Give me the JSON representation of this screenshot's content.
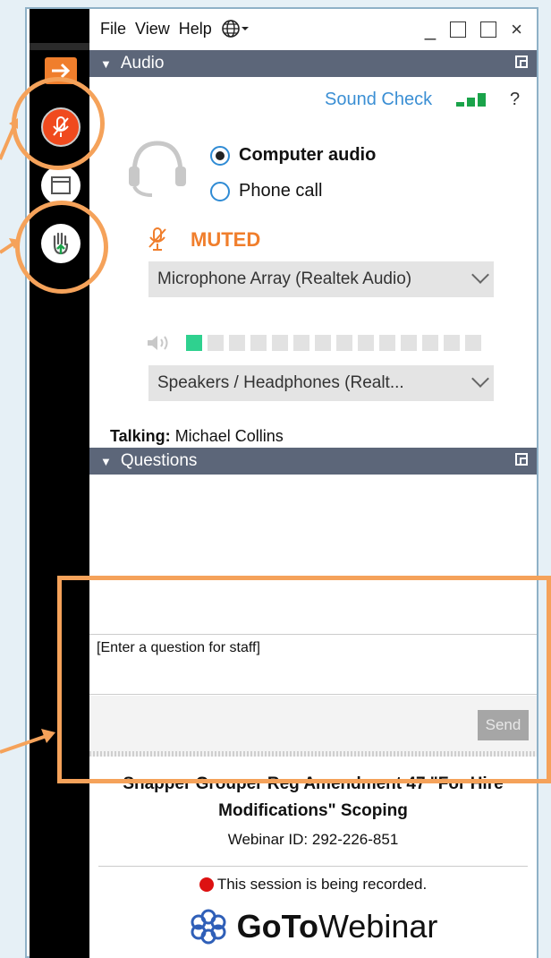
{
  "menu": {
    "file": "File",
    "view": "View",
    "help": "Help"
  },
  "audio": {
    "section_title": "Audio",
    "sound_check": "Sound Check",
    "help_mark": "?",
    "computer_audio": "Computer audio",
    "phone_call": "Phone call",
    "selected_option": "Computer audio",
    "mute_status": "MUTED",
    "microphone_select": "Microphone Array (Realtek Audio)",
    "speaker_select": "Speakers / Headphones (Realt...",
    "meter_level_segments": 1,
    "meter_total_segments": 14,
    "talking_label": "Talking:",
    "talking_name": "Michael Collins"
  },
  "questions": {
    "section_title": "Questions",
    "input_placeholder": "[Enter a question for staff]",
    "send_label": "Send"
  },
  "webinar": {
    "title": "Snapper Grouper Reg Amendment 47 \"For Hire Modifications\" Scoping",
    "id_line": "Webinar ID: 292-226-851",
    "recording_notice": "This session is being recorded.",
    "logo_goto": "GoTo",
    "logo_webinar": "Webinar"
  },
  "colors": {
    "accent_orange": "#f07e2c",
    "highlight": "#f5a25a",
    "section_bar": "#5c6679",
    "link_blue": "#3b8fd4",
    "meter_green": "#2fd18f"
  },
  "icons": [
    "expand-arrow-icon",
    "mic-muted-icon",
    "screen-icon",
    "hand-raise-icon",
    "globe-icon",
    "headset-icon",
    "speaker-icon",
    "signal-bars-icon",
    "recording-dot-icon",
    "gotowebinar-logo-icon"
  ]
}
